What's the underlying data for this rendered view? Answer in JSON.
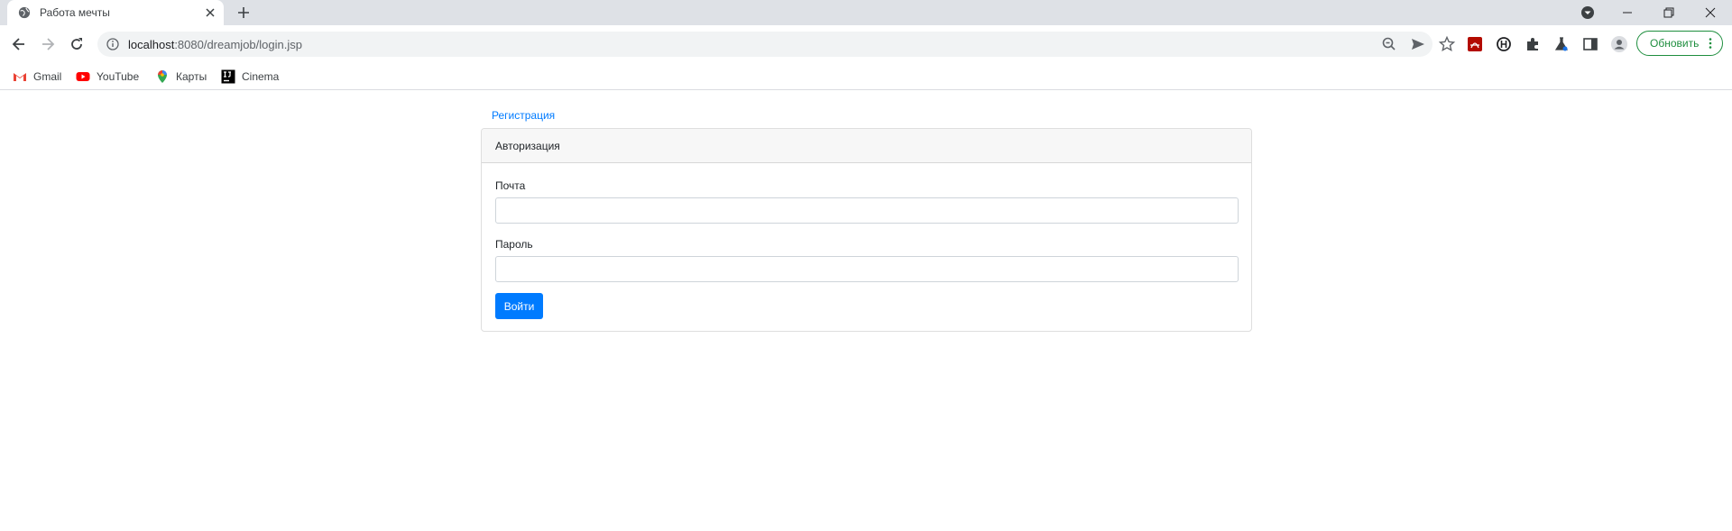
{
  "browser": {
    "tab": {
      "title": "Работа мечты"
    },
    "address": {
      "host": "localhost",
      "rest": ":8080/dreamjob/login.jsp"
    },
    "update_button": "Обновить",
    "bookmarks": [
      {
        "label": "Gmail",
        "icon": "gmail-icon"
      },
      {
        "label": "YouTube",
        "icon": "youtube-icon"
      },
      {
        "label": "Карты",
        "icon": "maps-icon"
      },
      {
        "label": "Cinema",
        "icon": "intellij-icon"
      }
    ]
  },
  "page": {
    "register_link": "Регистрация",
    "card": {
      "header": "Авторизация",
      "email_label": "Почта",
      "email_value": "",
      "password_label": "Пароль",
      "password_value": "",
      "submit_label": "Войти"
    }
  },
  "colors": {
    "accent": "#007bff",
    "update_green": "#1e8e3e",
    "tabstrip": "#dee1e6"
  }
}
